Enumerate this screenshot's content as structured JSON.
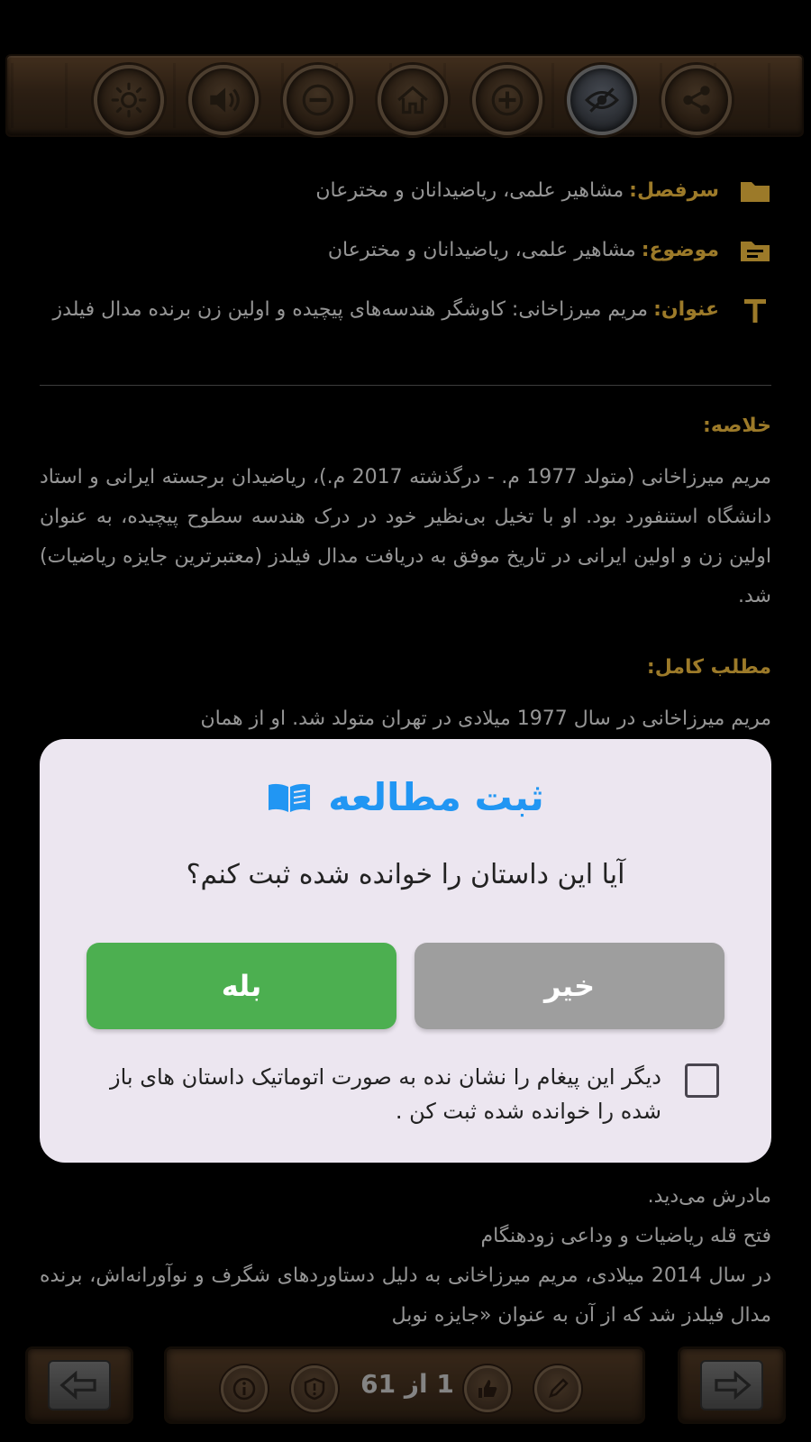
{
  "toolbar": {
    "buttons": [
      {
        "name": "share-icon"
      },
      {
        "name": "eye-off-icon",
        "active": true
      },
      {
        "name": "zoom-in-icon"
      },
      {
        "name": "home-icon"
      },
      {
        "name": "zoom-out-icon"
      },
      {
        "name": "volume-icon"
      },
      {
        "name": "brightness-icon"
      }
    ]
  },
  "meta": {
    "chapter_label": "سرفصل:",
    "chapter_value": "مشاهیر علمی، ریاضیدانان و مخترعان",
    "topic_label": "موضوع:",
    "topic_value": "مشاهیر علمی، ریاضیدانان و مخترعان",
    "title_label": "عنوان:",
    "title_value": "مریم میرزاخانی: کاوشگر هندسه‌های پیچیده و اولین زن برنده مدال فیلدز"
  },
  "summary": {
    "title": "خلاصه:",
    "text": "مریم میرزاخانی (متولد 1977 م. - درگذشته 2017 م.)، ریاضیدان برجسته ایرانی و استاد دانشگاه استنفورد بود. او با تخیل بی‌نظیر خود در درک هندسه سطوح پیچیده، به عنوان اولین زن و اولین ایرانی در تاریخ موفق به دریافت مدال فیلدز (معتبرترین جایزه ریاضیات) شد."
  },
  "full_text": {
    "title": "مطلب کامل:",
    "line1": "مریم میرزاخانی در سال 1977 میلادی در تهران متولد شد. او از همان",
    "line2": "مادرش می‌دید.",
    "line3": "فتح قله ریاضیات و وداعی زودهنگام",
    "line4": "در سال 2014 میلادی، مریم میرزاخانی به دلیل دستاوردهای شگرف و نوآورانه‌اش، برنده مدال فیلدز شد که از آن به عنوان «جایزه نوبل"
  },
  "bottom_bar": {
    "page_indicator": "1 از 61"
  },
  "dialog": {
    "title": "ثبت مطالعه",
    "question": "آیا این داستان را خوانده شده ثبت کنم؟",
    "no_label": "خیر",
    "yes_label": "بله",
    "checkbox_label": "دیگر این پیغام را نشان نده به صورت اتوماتیک داستان های باز شده را خوانده شده ثبت کن .",
    "checkbox_checked": false
  },
  "colors": {
    "accent_gold": "#d9a93a",
    "dialog_title_blue": "#2196f3",
    "yes_green": "#4caf50",
    "no_gray": "#9e9e9e",
    "dialog_bg": "#ece6f0"
  }
}
